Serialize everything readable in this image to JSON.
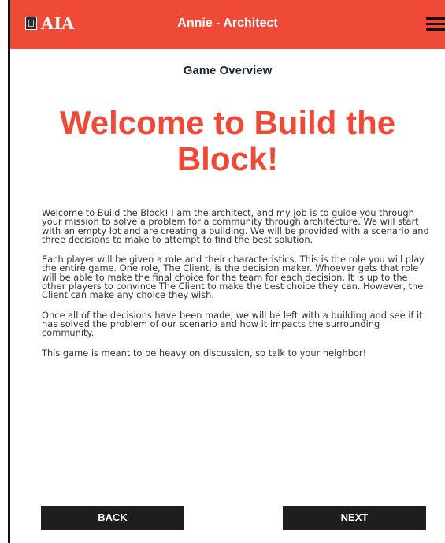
{
  "header": {
    "logo_text": "AIA",
    "title": "Annie - Architect",
    "background_color": "#ef4a37",
    "menu_icon": "hamburger-menu-icon"
  },
  "page": {
    "subtitle": "Game Overview",
    "headline": "Welcome to Build the Block!",
    "paragraphs": [
      "Welcome to Build the Block! I am the architect, and my job is to guide you through your mission to solve a problem for a community through architecture. We will start with an empty lot and are creating a building. We will be provided with a scenario and three decisions to make to attempt to find the best solution.",
      "Each player will be given a role and their characteristics. This is the role you will play the entire game. One role, The Client, is the decision maker. Whoever gets that role will be able to make the final choice for the team for each decision. It is up to the other players to convince The Client to make the best choice they can. However, the Client can make any choice they wish.",
      "Once all of the decisions have been made, we will be left with a building and see if it has solved the problem of our scenario and how it impacts the surrounding community.",
      "This game is meant to be heavy on discussion, so talk to your neighbor!"
    ]
  },
  "footer": {
    "back_label": "BACK",
    "next_label": "NEXT"
  },
  "colors": {
    "accent": "#ef4a37",
    "button": "#1e1e1e",
    "subtitle": "#1b2733"
  }
}
